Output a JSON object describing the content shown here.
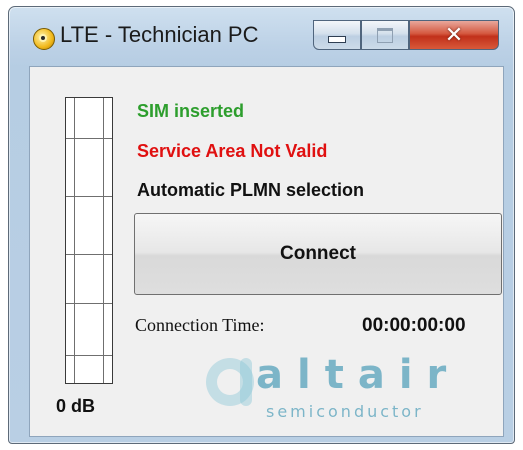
{
  "window": {
    "title": "LTE - Technician PC",
    "controls": {
      "minimize": "minimize",
      "maximize": "maximize",
      "close": "close"
    }
  },
  "colors": {
    "sim_status": "#2d9e2d",
    "service_status": "#e01010",
    "logo": "#1f86a8",
    "close_button": "#c1301a"
  },
  "icons": {
    "app": "app-icon",
    "minimize": "minimize-icon",
    "maximize": "maximize-icon",
    "close": "close-icon",
    "logo": "altair-logo-mark"
  },
  "signal": {
    "level_label": "0 dB",
    "filled_segments": 0
  },
  "status": {
    "sim": "SIM inserted",
    "service": "Service Area Not Valid",
    "plmn": "Automatic PLMN selection"
  },
  "connect": {
    "label": "Connect"
  },
  "connection": {
    "label": "Connection Time:",
    "value": "00:00:00:00"
  },
  "logo": {
    "word": "altair",
    "sub": "semiconductor"
  }
}
